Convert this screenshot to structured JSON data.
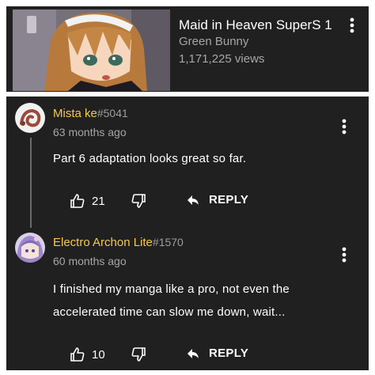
{
  "video": {
    "title": "Maid in Heaven SuperS 1",
    "channel": "Green Bunny",
    "views": "1,171,225 views",
    "menu_icon": "more-vert-icon"
  },
  "comments": [
    {
      "author": "Mista ke",
      "tag": "#5041",
      "time": "63 months ago",
      "text": "Part 6 adaptation looks great so far.",
      "likes": "21",
      "reply_label": "REPLY"
    },
    {
      "author": "Electro Archon Lite",
      "tag": "#1570",
      "time": "60 months ago",
      "text_lines": [
        "I finished my manga like a pro, not even the",
        "accelerated time can slow me down, wait..."
      ],
      "likes": "10",
      "reply_label": "REPLY"
    }
  ],
  "colors": {
    "background": "#202020",
    "author": "#f5c84c",
    "secondary_text": "#a6a6a6"
  }
}
